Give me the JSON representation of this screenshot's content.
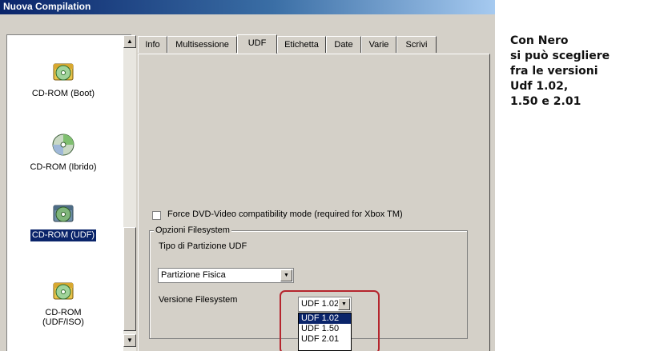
{
  "window": {
    "title": "Nuova Compilation"
  },
  "categories": [
    {
      "label": "CD-ROM (Boot)",
      "icon": "cd-boot-icon",
      "selected": false
    },
    {
      "label": "CD-ROM (Ibrido)",
      "icon": "cd-hybrid-icon",
      "selected": false
    },
    {
      "label": "CD-ROM (UDF)",
      "icon": "cd-udf-icon",
      "selected": true
    },
    {
      "label_line1": "CD-ROM",
      "label_line2": "(UDF/ISO)",
      "icon": "cd-udf-iso-icon",
      "selected": false
    }
  ],
  "tabs": [
    {
      "label": "Info",
      "active": false
    },
    {
      "label": "Multisessione",
      "active": false
    },
    {
      "label": "UDF",
      "active": true
    },
    {
      "label": "Etichetta",
      "active": false
    },
    {
      "label": "Date",
      "active": false
    },
    {
      "label": "Varie",
      "active": false
    },
    {
      "label": "Scrivi",
      "active": false
    }
  ],
  "udf": {
    "force_dvd_label": "Force DVD-Video compatibility mode (required for Xbox TM)",
    "force_dvd_checked": false,
    "group_title": "Opzioni Filesystem",
    "partition_label": "Tipo di Partizione UDF",
    "partition_value": "Partizione Fisica",
    "version_label": "Versione Filesystem",
    "version_value": "UDF 1.02",
    "version_options": [
      "UDF 1.02",
      "UDF 1.50",
      "UDF 2.01"
    ],
    "version_selected_index": 0
  },
  "colors": {
    "selection": "#0a246a",
    "highlight_border": "#b5252d",
    "dialog_bg": "#d4d0c8"
  },
  "caption": {
    "lines": [
      "Con Nero",
      "si può scegliere",
      "fra le versioni",
      "Udf 1.02,",
      "1.50 e 2.01"
    ]
  }
}
